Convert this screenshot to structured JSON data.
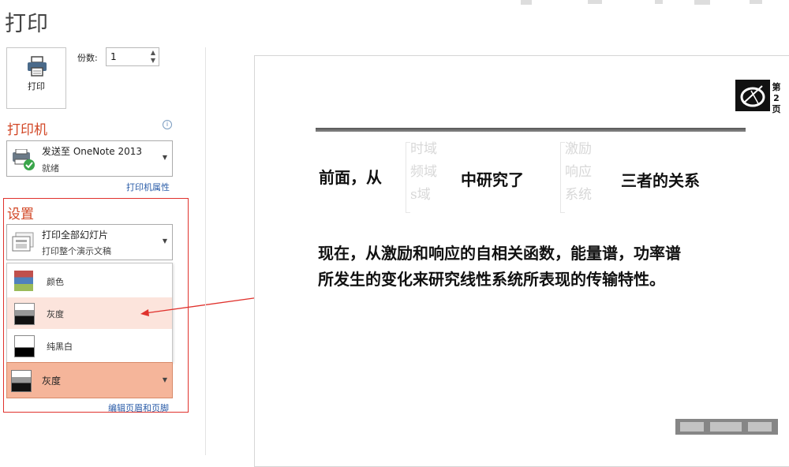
{
  "title": "打印",
  "print_button": {
    "label": "打印"
  },
  "copies": {
    "label": "份数:",
    "value": "1"
  },
  "printer": {
    "heading": "打印机",
    "name": "发送至 OneNote 2013",
    "status": "就绪",
    "properties_link": "打印机属性"
  },
  "settings": {
    "heading": "设置",
    "slides_title": "打印全部幻灯片",
    "slides_sub": "打印整个演示文稿",
    "color_options": [
      "颜色",
      "灰度",
      "纯黑白"
    ],
    "color_selected": "灰度",
    "edit_header_link": "编辑页眉和页脚"
  },
  "preview": {
    "page_number": "第2页",
    "line1_a": "前面，从",
    "faint_col1": [
      "时域",
      "频域",
      "s域"
    ],
    "line1_b": "中研究了",
    "faint_col2": [
      "激励",
      "响应",
      "系统"
    ],
    "line1_c": "三者的关系",
    "paragraph_1": "现在，从激励和响应的自相关函数，能量谱，功率谱",
    "paragraph_2": "所发生的变化来研究线性系统所表现的传输特性。"
  },
  "colors": {
    "accent": "#d24726",
    "selected_bg": "#f5b59a",
    "link": "#2a5ca8",
    "annotation_red": "#e0322d"
  }
}
